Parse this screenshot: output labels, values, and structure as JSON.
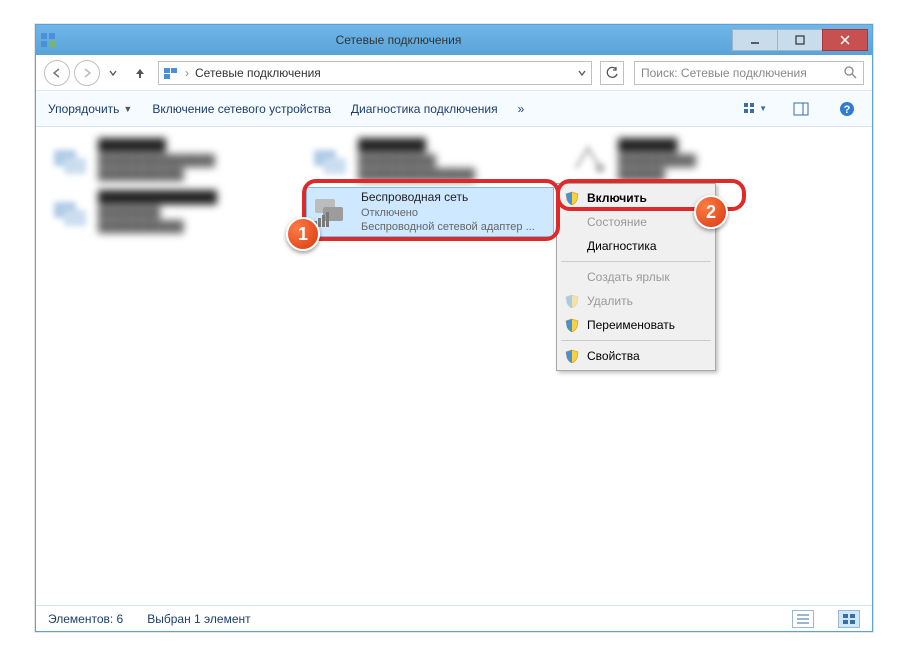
{
  "titlebar": {
    "title": "Сетевые подключения"
  },
  "nav": {
    "breadcrumb": "Сетевые подключения"
  },
  "search": {
    "placeholder": "Поиск: Сетевые подключения"
  },
  "toolbar": {
    "organize": "Упорядочить",
    "enable_device": "Включение сетевого устройства",
    "diagnose": "Диагностика подключения",
    "overflow": "»"
  },
  "items": {
    "wireless": {
      "name": "Беспроводная сеть",
      "status": "Отключено",
      "adapter": "Беспроводной сетевой адаптер ..."
    }
  },
  "context_menu": {
    "enable": "Включить",
    "status": "Состояние",
    "diagnose": "Диагностика",
    "shortcut": "Создать ярлык",
    "delete": "Удалить",
    "rename": "Переименовать",
    "properties": "Свойства"
  },
  "statusbar": {
    "count": "Элементов: 6",
    "selected": "Выбран 1 элемент"
  },
  "badges": {
    "one": "1",
    "two": "2"
  }
}
